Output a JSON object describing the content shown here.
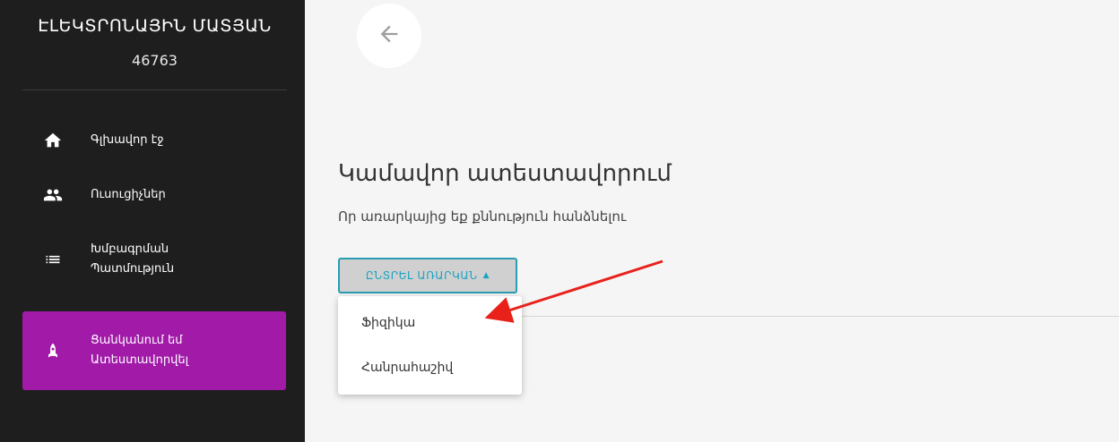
{
  "sidebar": {
    "title": "ԷԼԵԿՏՐՈՆԱՅԻՆ ՄԱՏՅԱՆ",
    "id_number": "46763",
    "items": [
      {
        "label": "Գլխավոր էջ",
        "icon": "home-icon"
      },
      {
        "label": "Ուսուցիչներ",
        "icon": "people-icon"
      },
      {
        "label": "Խմբագրման\nՊատմություն",
        "icon": "list-icon"
      },
      {
        "label": "Ցանկանում եմ\nԱտեստավորվել",
        "icon": "rocket-icon"
      }
    ]
  },
  "main": {
    "title": "Կամավոր ատեստավորում",
    "subtitle": "Որ առարկայից եք քննություն հանձնելու",
    "select_label": "ԸՆՏՐԵԼ ԱՌԱՐԿԱՆ",
    "dropdown_options": [
      "Ֆիզիկա",
      "Հանրահաշիվ"
    ]
  },
  "colors": {
    "sidebar_bg": "#1e1e1e",
    "active_item": "#a11aa8",
    "select_accent": "#1aa3c2",
    "annotation_arrow": "#e8221b"
  }
}
